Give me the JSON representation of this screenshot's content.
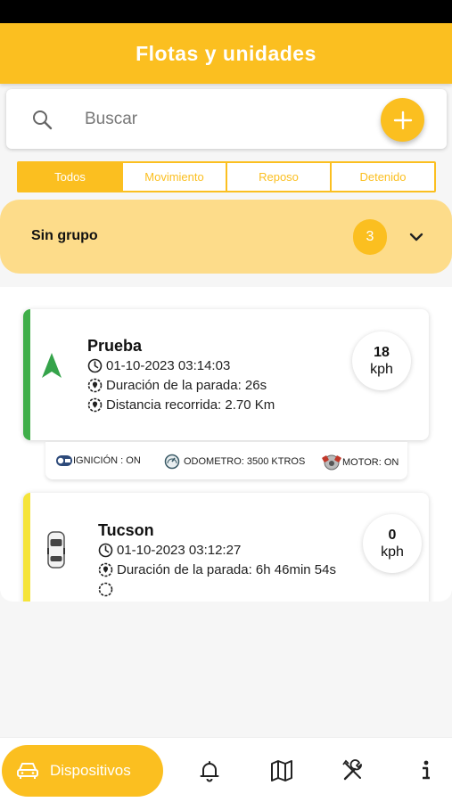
{
  "header": {
    "title": "Flotas y unidades"
  },
  "search": {
    "placeholder": "Buscar",
    "icon": "search-icon"
  },
  "actions": {
    "add_icon": "plus-icon"
  },
  "filters": {
    "tabs": [
      {
        "label": "Todos",
        "active": true
      },
      {
        "label": "Movimiento",
        "active": false
      },
      {
        "label": "Reposo",
        "active": false
      },
      {
        "label": "Detenido",
        "active": false
      }
    ]
  },
  "group": {
    "title": "Sin grupo",
    "count": "3"
  },
  "vehicles": [
    {
      "name": "Prueba",
      "datetime": "01-10-2023 03:14:03",
      "stop_duration": "Duración de la parada: 26s",
      "distance": "Distancia recorrida: 2.70 Km",
      "speed": "18",
      "speed_unit": "kph",
      "accent": "#3fae49",
      "icon": "navigation-arrow-icon"
    },
    {
      "name": "Tucson",
      "datetime": "01-10-2023 03:12:27",
      "stop_duration": "Duración de la parada: 6h 46min 54s",
      "speed": "0",
      "speed_unit": "kph",
      "accent": "#f5e43a",
      "icon": "car-icon"
    }
  ],
  "status_strip": {
    "ignition": "IGNICIÓN : ON",
    "odometer": "ODOMETRO: 3500 KTROS",
    "motor": "MOTOR: ON"
  },
  "bottom_nav": {
    "active_label": "Dispositivos",
    "items": [
      "car-icon",
      "bell-icon",
      "map-icon",
      "tools-icon",
      "info-icon"
    ]
  },
  "colors": {
    "accent": "#fbbf20",
    "group_bg": "#fddc8a"
  }
}
